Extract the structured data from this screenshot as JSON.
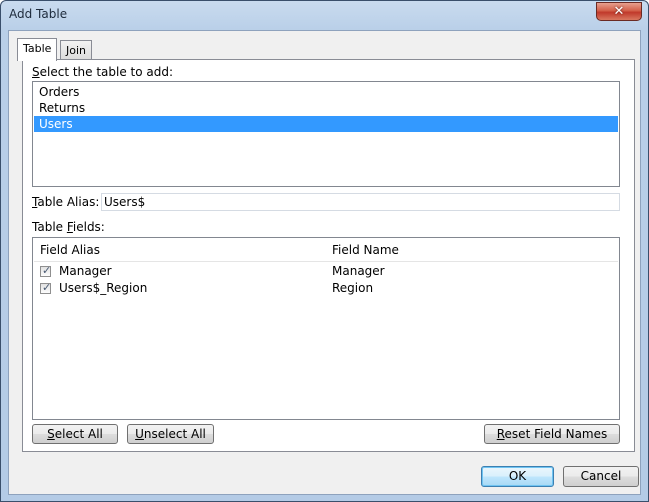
{
  "window": {
    "title": "Add Table",
    "close_glyph": "✕"
  },
  "tabs": [
    {
      "label": "Table",
      "active": true
    },
    {
      "label": "Join",
      "active": false
    }
  ],
  "select_table": {
    "label_pre": "",
    "label_accel": "S",
    "label_post": "elect the table to add:",
    "items": [
      {
        "label": "Orders",
        "selected": false
      },
      {
        "label": "Returns",
        "selected": false
      },
      {
        "label": "Users",
        "selected": true
      }
    ]
  },
  "alias": {
    "label_accel": "T",
    "label_post": "able Alias:",
    "value": "Users$"
  },
  "fields": {
    "label_pre": "Table ",
    "label_accel": "F",
    "label_post": "ields:",
    "columns": [
      "Field Alias",
      "Field Name"
    ],
    "rows": [
      {
        "checked": true,
        "alias": "Manager",
        "name": "Manager"
      },
      {
        "checked": true,
        "alias": "Users$_Region",
        "name": "Region"
      }
    ]
  },
  "buttons": {
    "select_all": {
      "accel": "S",
      "rest": "elect All"
    },
    "unselect_all": {
      "accel": "U",
      "rest": "nselect All"
    },
    "reset": {
      "accel": "R",
      "rest": "eset Field Names"
    },
    "ok": "OK",
    "cancel": "Cancel"
  },
  "colors": {
    "selection": "#3399ff",
    "close_button": "#c0392b"
  }
}
